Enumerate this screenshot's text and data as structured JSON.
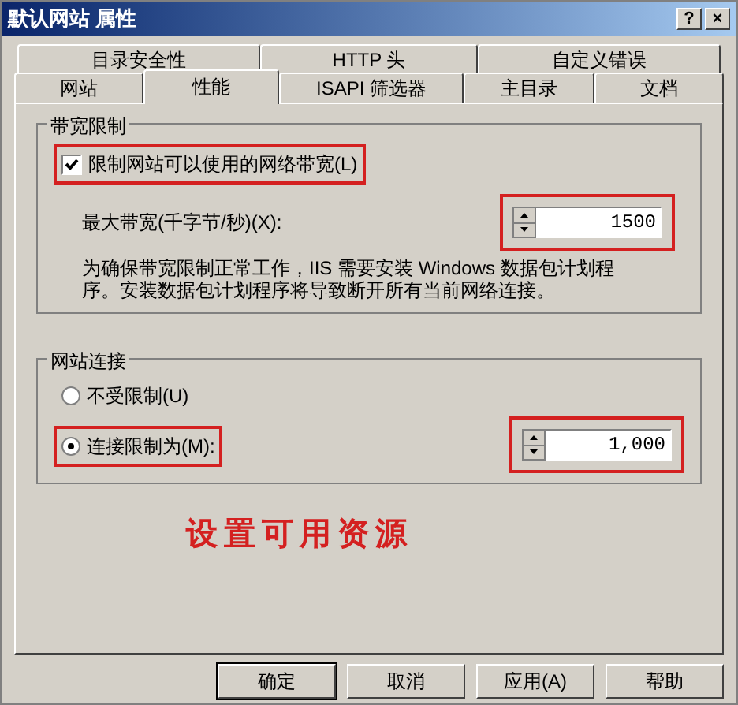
{
  "window": {
    "title": "默认网站 属性",
    "buttons": [
      "?",
      "×"
    ]
  },
  "tabs": [
    [
      {
        "label": "目录安全性",
        "selected": false
      },
      {
        "label": "HTTP 头",
        "selected": false
      },
      {
        "label": "自定义错误",
        "selected": false
      }
    ],
    [
      {
        "label": "网站",
        "selected": false
      },
      {
        "label": "性能",
        "selected": true
      },
      {
        "label": "ISAPI 筛选器",
        "selected": false
      },
      {
        "label": "主目录",
        "selected": false
      },
      {
        "label": "文档",
        "selected": false
      }
    ]
  ],
  "bandwidth": {
    "title": "带宽限制",
    "checkbox": {
      "label": "限制网站可以使用的网络带宽(L)",
      "checked": true,
      "highlighted": true
    },
    "max_label": "最大带宽(千字节/秒)(X):",
    "max_value": "1500",
    "max_highlighted": true,
    "note": "为确保带宽限制正常工作，IIS 需要安装 Windows 数据包计划程序。安装数据包计划程序将导致断开所有当前网络连接。"
  },
  "connections": {
    "title": "网站连接",
    "options": [
      {
        "label": "不受限制(U)",
        "selected": false,
        "highlighted": false
      },
      {
        "label": "连接限制为(M):",
        "selected": true,
        "highlighted": true
      }
    ],
    "limit_value": "1,000",
    "limit_highlighted": true
  },
  "annotation": "设置可用资源",
  "buttons": [
    {
      "label": "确定",
      "default": true
    },
    {
      "label": "取消",
      "default": false
    },
    {
      "label": "应用(A)",
      "default": false
    },
    {
      "label": "帮助",
      "default": false
    }
  ]
}
